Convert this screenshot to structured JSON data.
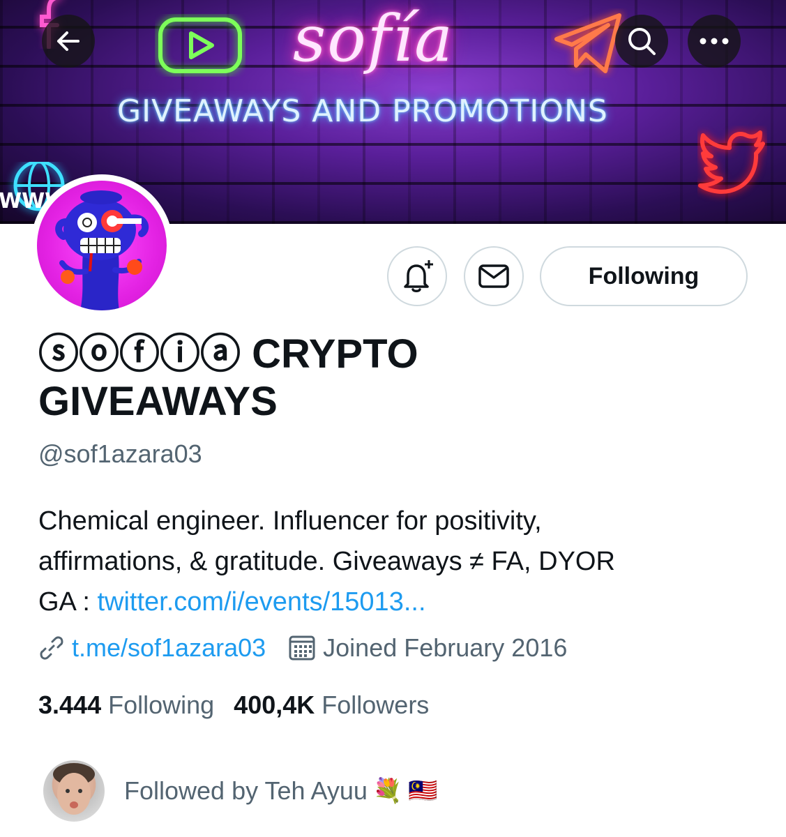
{
  "banner": {
    "title": "sofía",
    "subtitle": "GIVEAWAYS AND PROMOTIONS",
    "www_text": "WWW",
    "icons": [
      "facebook-neon-icon",
      "youtube-neon-icon",
      "telegram-neon-icon",
      "twitter-neon-icon",
      "globe-neon-icon"
    ],
    "nav_icons": [
      "back-arrow-icon",
      "search-icon",
      "more-icon"
    ]
  },
  "actions": {
    "notify_icon": "bell-plus-icon",
    "message_icon": "envelope-icon",
    "follow_label": "Following"
  },
  "profile": {
    "display_name": "ⓢⓞⓕⓘⓐ CRYPTO GIVEAWAYS",
    "handle": "@sof1azara03",
    "bio_line1": "Chemical engineer. Influencer for positivity,",
    "bio_line2": "affirmations, & gratitude. Giveaways ≠ FA, DYOR",
    "bio_line3_prefix": "GA : ",
    "bio_link": "twitter.com/i/events/15013...",
    "website": "t.me/sof1azara03",
    "joined": "Joined February 2016"
  },
  "stats": {
    "following_count": "3.444",
    "following_label": "Following",
    "followers_count": "400,4K",
    "followers_label": "Followers"
  },
  "followed_by": {
    "text": "Followed by Teh Ayuu",
    "emoji_1": "💐",
    "emoji_2": "🇲🇾"
  },
  "colors": {
    "link_blue": "#1d9bf0",
    "secondary_text": "#536471",
    "primary_text": "#0f1419",
    "border": "#cfd9de"
  }
}
